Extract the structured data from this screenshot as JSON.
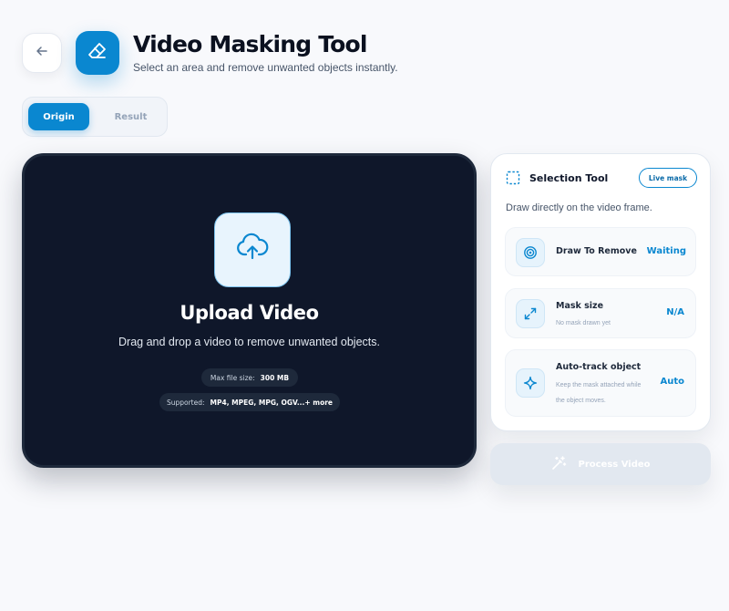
{
  "header": {
    "title": "Video Masking Tool",
    "subtitle": "Select an area and remove unwanted objects instantly."
  },
  "tabs": [
    {
      "label": "Origin",
      "active": true
    },
    {
      "label": "Result",
      "active": false
    }
  ],
  "upload": {
    "title": "Upload Video",
    "description": "Drag and drop a video to remove unwanted objects.",
    "max_size_label": "Max file size:",
    "max_size_value": "300 MB",
    "supported_label": "Supported:",
    "supported_value": "MP4, MPEG, MPG, OGV...+ more"
  },
  "panel": {
    "title": "Selection Tool",
    "badge": "Live mask",
    "description": "Draw directly on the video frame.",
    "cards": [
      {
        "title": "Draw To Remove",
        "subtitle": "",
        "status": "Waiting",
        "icon": "target-icon"
      },
      {
        "title": "Mask size",
        "subtitle": "No mask drawn yet",
        "status": "N/A",
        "icon": "expand-icon"
      },
      {
        "title": "Auto-track object",
        "subtitle": "Keep the mask attached while the object moves.",
        "status": "Auto",
        "icon": "sparkle-icon"
      }
    ]
  },
  "process_button": {
    "label": "Process Video",
    "enabled": false
  },
  "colors": {
    "accent": "#0a87d0",
    "dark_panel": "#0f172a",
    "background": "#f8f9fc"
  }
}
